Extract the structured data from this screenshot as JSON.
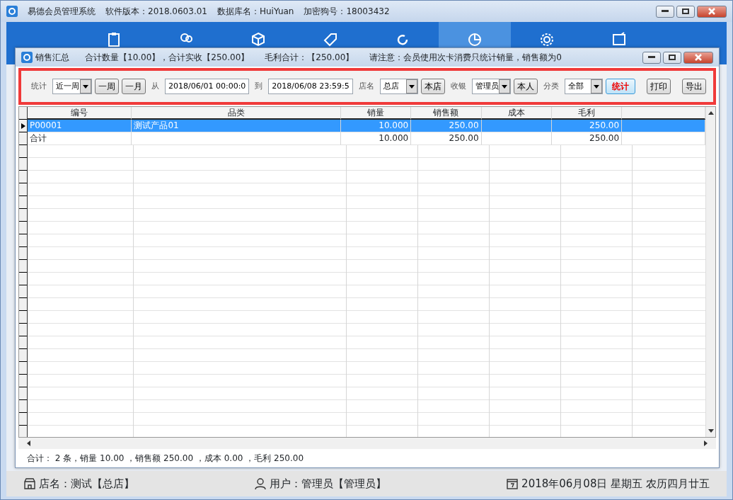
{
  "window": {
    "title": "易德会员管理系统",
    "version": "软件版本：2018.0603.01",
    "database": "数据库名：HuiYuan",
    "dongle": "加密狗号：18003432"
  },
  "nav": [
    {
      "kind": "clipboard",
      "selected": false
    },
    {
      "kind": "people",
      "selected": false
    },
    {
      "kind": "box",
      "selected": false
    },
    {
      "kind": "tag",
      "selected": false
    },
    {
      "kind": "refresh",
      "selected": false
    },
    {
      "kind": "pie",
      "selected": true
    },
    {
      "kind": "gear",
      "selected": false
    },
    {
      "kind": "window",
      "selected": false
    }
  ],
  "dialog": {
    "title": "销售汇总",
    "total_qty": "合计数量【10.00】，合计实收【250.00】",
    "profit": "毛利合计：【250.00】",
    "notice": "请注意：会员使用次卡消费只统计销量，销售额为0"
  },
  "filter": {
    "stat_label": "统计",
    "period": "近一周",
    "week_button": "一周",
    "month_button": "一月",
    "from_label": "从",
    "from": "2018/06/01 00:00:0",
    "to_label": "到",
    "to": "2018/06/08 23:59:5",
    "shop_label": "店名",
    "shop": "总店",
    "my_shop_button": "本店",
    "cashier_label": "收银",
    "cashier": "管理员",
    "me_button": "本人",
    "category_label": "分类",
    "category": "全部",
    "stat_button": "统计",
    "print_button": "打印",
    "export_button": "导出"
  },
  "table": {
    "columns": [
      "编号",
      "品类",
      "销量",
      "销售额",
      "成本",
      "毛利"
    ],
    "rows": [
      {
        "cells": [
          "P00001",
          "测试产品01",
          "10.000",
          "250.00",
          "",
          "250.00"
        ],
        "selected": true
      },
      {
        "cells": [
          "合计",
          "",
          "10.000",
          "250.00",
          "",
          "250.00"
        ],
        "selected": false
      }
    ]
  },
  "summary": "合计： 2 条，销量 10.00 ，销售额 250.00 ，成本 0.00 ，毛利 250.00",
  "status_bar": {
    "shop": "店名：测试【总店】",
    "user": "用户：管理员【管理员】",
    "date": "2018年06月08日 星期五 农历四月廿五"
  }
}
